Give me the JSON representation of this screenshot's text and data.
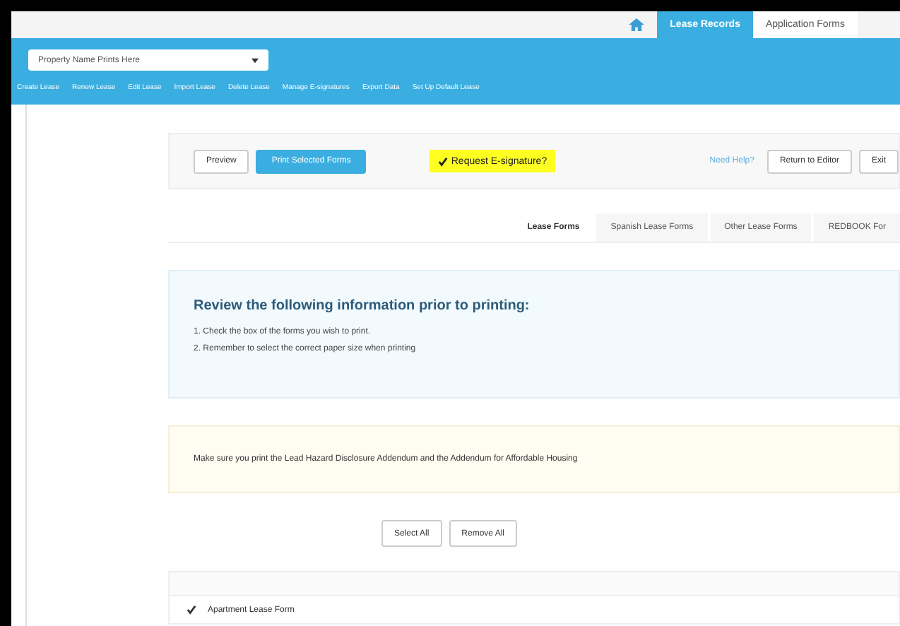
{
  "header": {
    "tabs": [
      {
        "label": "Lease Records",
        "selected": true
      },
      {
        "label": "Application Forms",
        "selected": false
      }
    ]
  },
  "property_select": {
    "value": "Property Name Prints Here"
  },
  "nav": [
    "Create Lease",
    "Renew Lease",
    "Edit Lease",
    "Import Lease",
    "Delete Lease",
    "Manage E-signatures",
    "Export Data",
    "Set Up Default Lease"
  ],
  "toolbar": {
    "preview": "Preview",
    "print": "Print Selected Forms",
    "esignature": {
      "label": "Request E-signature?",
      "checked": true
    },
    "help": "Need Help?",
    "return": "Return to Editor",
    "exit": "Exit"
  },
  "form_tabs": [
    {
      "label": "Lease Forms",
      "selected": true
    },
    {
      "label": "Spanish Lease Forms",
      "selected": false
    },
    {
      "label": "Other Lease Forms",
      "selected": false
    },
    {
      "label": "REDBOOK For",
      "selected": false
    }
  ],
  "info": {
    "heading": "Review the following information prior to printing:",
    "items": [
      "1. Check the box of the forms you wish to print.",
      "2. Remember to select the correct paper size when printing"
    ]
  },
  "notice": "Make sure you print the Lead Hazard Disclosure Addendum and the Addendum for Affordable Housing",
  "select_all": "Select All",
  "remove_all": "Remove All",
  "forms": [
    {
      "label": "Apartment Lease Form",
      "checked": true
    }
  ]
}
